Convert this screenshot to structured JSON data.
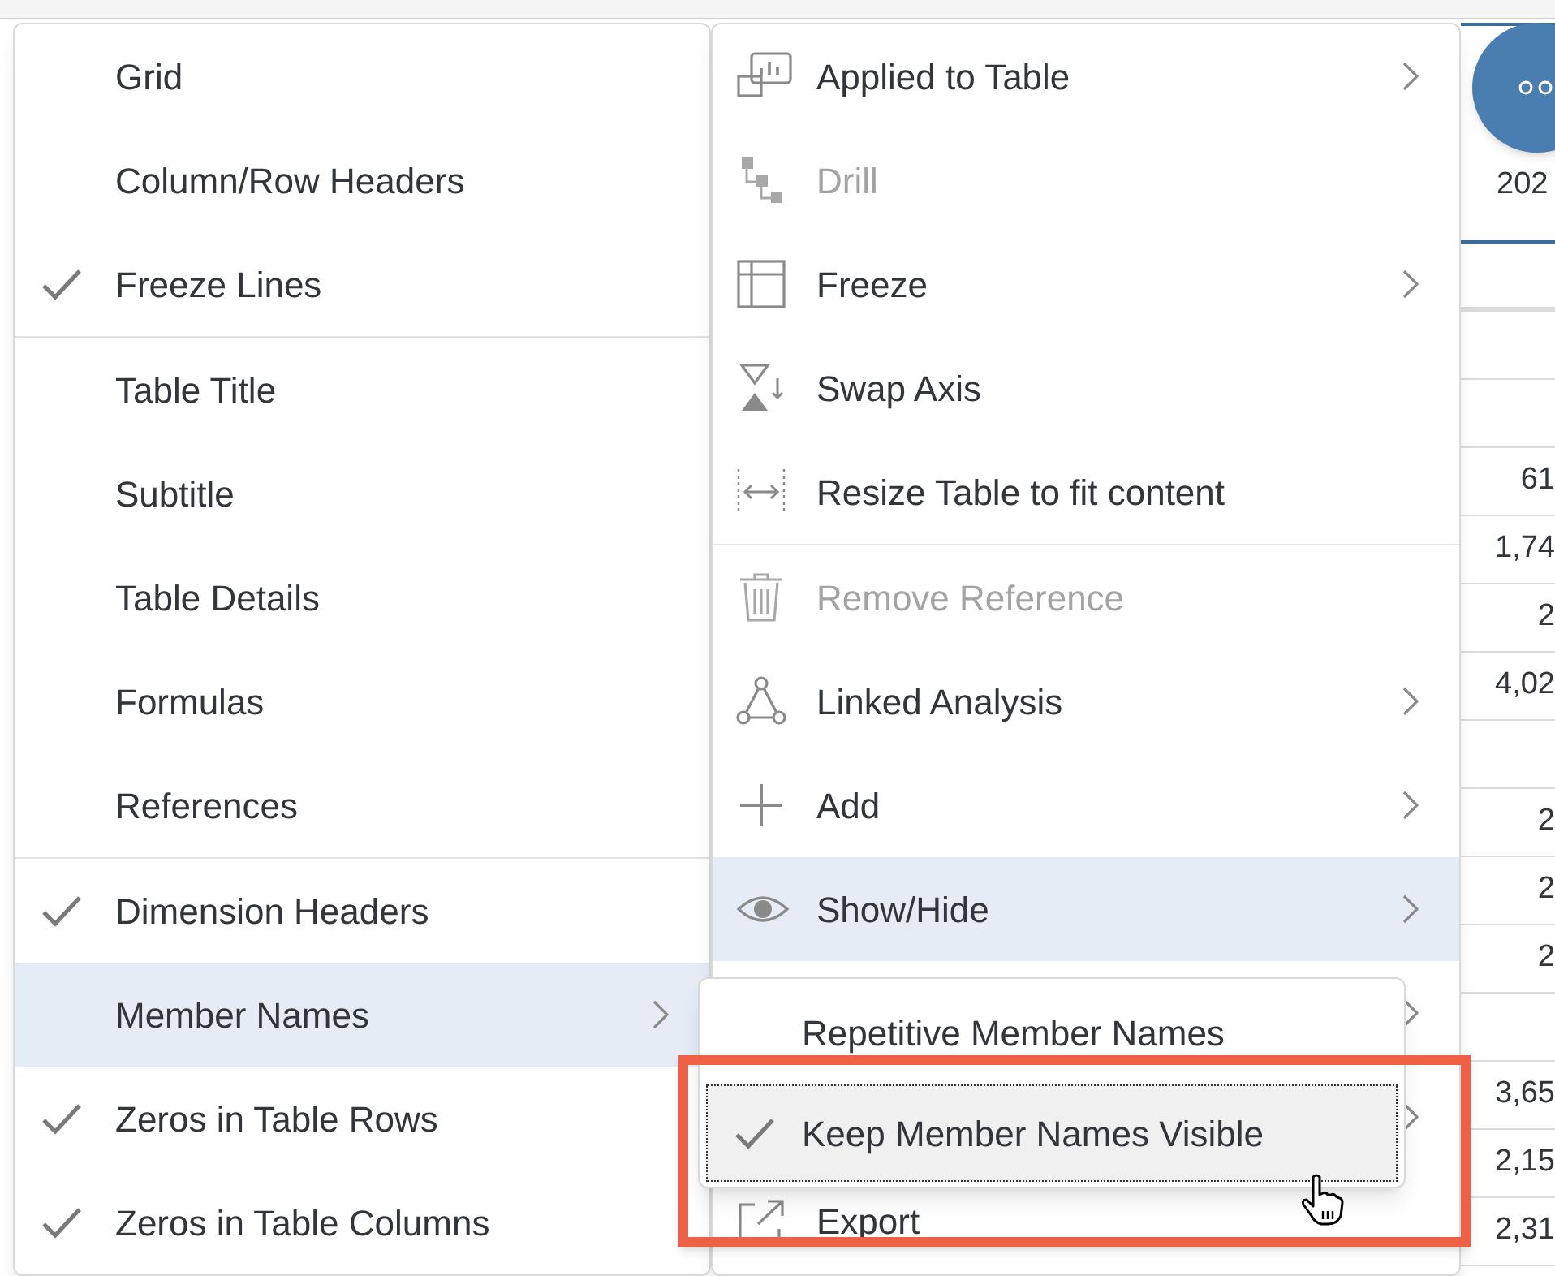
{
  "table": {
    "header": [
      "202"
    ],
    "rows": [
      "",
      "",
      "",
      "61",
      "1,74",
      "2",
      "4,02",
      "",
      "2",
      "2",
      "2",
      "",
      "3,65",
      "2,15",
      "2,31"
    ]
  },
  "format_menu": {
    "groups": [
      [
        {
          "label": "Grid",
          "checked": false,
          "submenu": false,
          "selected": false
        },
        {
          "label": "Column/Row Headers",
          "checked": false,
          "submenu": false,
          "selected": false
        },
        {
          "label": "Freeze Lines",
          "checked": true,
          "submenu": false,
          "selected": false
        }
      ],
      [
        {
          "label": "Table Title",
          "checked": false,
          "submenu": false,
          "selected": false
        },
        {
          "label": "Subtitle",
          "checked": false,
          "submenu": false,
          "selected": false
        },
        {
          "label": "Table Details",
          "checked": false,
          "submenu": false,
          "selected": false
        },
        {
          "label": "Formulas",
          "checked": false,
          "submenu": false,
          "selected": false
        },
        {
          "label": "References",
          "checked": false,
          "submenu": false,
          "selected": false
        }
      ],
      [
        {
          "label": "Dimension Headers",
          "checked": true,
          "submenu": false,
          "selected": false
        },
        {
          "label": "Member Names",
          "checked": false,
          "submenu": true,
          "selected": true
        },
        {
          "label": "Zeros in Table Rows",
          "checked": true,
          "submenu": false,
          "selected": false
        },
        {
          "label": "Zeros in Table Columns",
          "checked": true,
          "submenu": false,
          "selected": false
        }
      ]
    ]
  },
  "context_menu": {
    "groups": [
      [
        {
          "kind": "item",
          "label": "Applied to Table",
          "submenu": true,
          "disabled": false,
          "selected": false
        },
        {
          "kind": "item",
          "label": "Drill",
          "submenu": false,
          "disabled": true,
          "selected": false
        },
        {
          "kind": "item",
          "label": "Freeze",
          "submenu": true,
          "disabled": false,
          "selected": false
        },
        {
          "kind": "item",
          "label": "Swap Axis",
          "submenu": false,
          "disabled": false,
          "selected": false
        },
        {
          "kind": "item",
          "label": "Resize Table to fit content",
          "submenu": false,
          "disabled": false,
          "selected": false
        }
      ],
      [
        {
          "kind": "item",
          "label": "Remove Reference",
          "submenu": false,
          "disabled": true,
          "selected": false
        },
        {
          "kind": "item",
          "label": "Linked Analysis",
          "submenu": true,
          "disabled": false,
          "selected": false
        },
        {
          "kind": "item",
          "label": "Add",
          "submenu": true,
          "disabled": false,
          "selected": false
        },
        {
          "kind": "item",
          "label": "Show/Hide",
          "submenu": true,
          "disabled": false,
          "selected": true
        },
        {
          "kind": "covered",
          "submenu": true,
          "selected": false
        },
        {
          "kind": "covered",
          "submenu": true,
          "selected": false
        },
        {
          "kind": "item",
          "label": "Export",
          "submenu": false,
          "disabled": false,
          "selected": false
        }
      ]
    ]
  },
  "member_names_menu": {
    "items": [
      {
        "label": "Repetitive Member Names",
        "checked": false,
        "focused": false
      },
      {
        "label": "Keep Member Names Visible",
        "checked": true,
        "focused": true
      }
    ]
  }
}
